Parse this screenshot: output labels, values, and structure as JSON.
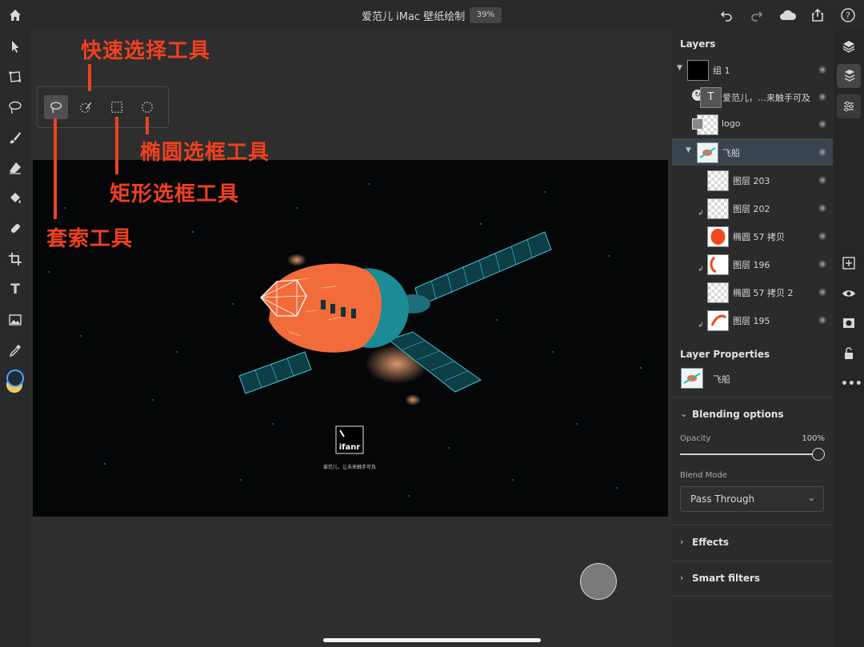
{
  "topbar": {
    "title": "爱范儿 iMac 壁纸绘制",
    "zoom": "39%",
    "icons": [
      "home-icon",
      "undo-icon",
      "redo-icon",
      "cloud-icon",
      "share-icon",
      "help-icon"
    ]
  },
  "left_tools": [
    "select-icon",
    "transform-icon",
    "lasso-icon",
    "brush-icon",
    "eraser-icon",
    "fill-icon",
    "healing-icon",
    "crop-icon",
    "type-icon",
    "image-icon",
    "eyedropper-icon",
    "color-swatch"
  ],
  "colors": {
    "accent": "#f0401f",
    "foreground_swatch": "#1e2a38",
    "background_swatch": "#f5c842",
    "selected_layer": "#3a4451"
  },
  "annotations": {
    "quick_select": "快速选择工具",
    "ellipse": "椭圆选框工具",
    "rect": "矩形选框工具",
    "lasso": "套索工具"
  },
  "artboard": {
    "logo_text": "ifanr",
    "caption": "爱范儿，让未来触手可及"
  },
  "layers": {
    "title": "Layers",
    "items": [
      {
        "name": "组 1",
        "type": "group"
      },
      {
        "name": "爱范儿，…来触手可及",
        "type": "text"
      },
      {
        "name": "logo",
        "type": "smart"
      },
      {
        "name": "飞船",
        "type": "group"
      },
      {
        "name": "图层 203",
        "type": "pixel"
      },
      {
        "name": "图层 202",
        "type": "pixel"
      },
      {
        "name": "椭圆 57 拷贝",
        "type": "pixel"
      },
      {
        "name": "图层 196",
        "type": "pixel"
      },
      {
        "name": "椭圆 57 拷贝 2",
        "type": "pixel"
      },
      {
        "name": "图层 195",
        "type": "pixel"
      }
    ]
  },
  "properties": {
    "title": "Layer Properties",
    "layer_name": "飞船",
    "blending_label": "Blending options",
    "opacity_label": "Opacity",
    "opacity_value": "100%",
    "opacity_fraction": 1.0,
    "blend_mode_label": "Blend Mode",
    "blend_mode_value": "Pass Through",
    "effects_label": "Effects",
    "smart_filters_label": "Smart filters"
  },
  "right_tools": [
    "layers-icon",
    "layer-properties-icon",
    "adjustments-icon",
    "add-layer-icon",
    "visibility-icon",
    "mask-icon",
    "lock-icon",
    "more-icon"
  ]
}
